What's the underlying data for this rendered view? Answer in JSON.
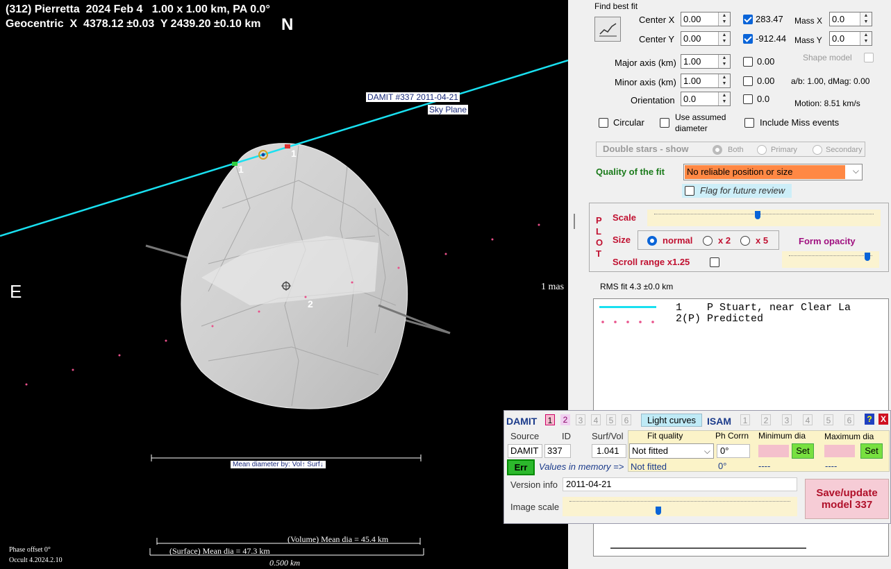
{
  "plot": {
    "title_line1": "(312) Pierretta  2024 Feb 4   1.00 x 1.00 km, PA 0.0°",
    "title_line2": "Geocentric  X  4378.12 ±0.03  Y 2439.20 ±0.10 km",
    "north": "N",
    "east": "E",
    "scale_mas": "1 mas",
    "damit_label_1": "DAMIT #337 2011-04-21",
    "damit_label_2": "Sky Plane",
    "chord_label_1": "1",
    "chord_label_1b": "1",
    "chord_label_2": "2",
    "mean_dia_label": "Mean diameter by:  Vol↑  Surf↓",
    "volume_dia": "(Volume) Mean dia = 45.4 km",
    "surface_dia": "(Surface) Mean dia = 47.3 km",
    "scale_bar_label": "0.500 km",
    "phase_offset": "Phase offset 0°",
    "version": "Occult 4.2024.2.10"
  },
  "fit": {
    "group_title": "Find best fit",
    "center_x_label": "Center X",
    "center_x_value": "0.00",
    "center_x_checked_value": "283.47",
    "center_y_label": "Center Y",
    "center_y_value": "0.00",
    "center_y_checked_value": "-912.44",
    "mass_x_label": "Mass X",
    "mass_x_value": "0.0",
    "mass_y_label": "Mass Y",
    "mass_y_value": "0.0",
    "major_label": "Major axis (km)",
    "major_value": "1.00",
    "major_check": "0.00",
    "minor_label": "Minor axis (km)",
    "minor_value": "1.00",
    "minor_check": "0.00",
    "orientation_label": "Orientation",
    "orientation_value": "0.0",
    "orientation_check": "0.0",
    "shape_model_label": "Shape model",
    "ab_text": "a/b: 1.00, dMag: 0.00",
    "motion_text": "Motion: 8.51 km/s",
    "circular_label": "Circular",
    "assumed_label_1": "Use assumed",
    "assumed_label_2": "diameter",
    "miss_label": "Include Miss events",
    "double_stars_label": "Double stars - show",
    "both_label": "Both",
    "primary_label": "Primary",
    "secondary_label": "Secondary",
    "quality_label": "Quality of the fit",
    "quality_value": "No reliable position or size",
    "flag_label": "Flag for future review"
  },
  "plotctl": {
    "side_letters": [
      "P",
      "L",
      "O",
      "T"
    ],
    "scale_label": "Scale",
    "scale_fraction": 0.47,
    "size_label": "Size",
    "size_normal": "normal",
    "size_x2": "x 2",
    "size_x5": "x 5",
    "form_opacity_label": "Form opacity",
    "opacity_fraction": 0.97,
    "scroll_label": "Scroll range x1.25"
  },
  "rms": {
    "label": "RMS fit 4.3 ±0.0 km"
  },
  "legend": {
    "row1": "1    P Stuart, near Clear La",
    "row2": "2(P) Predicted"
  },
  "damit": {
    "title": "DAMIT",
    "tabs": [
      "1",
      "2",
      "3",
      "4",
      "5",
      "6"
    ],
    "light_curves": "Light curves",
    "isam": "ISAM",
    "isam_tabs": [
      "1",
      "2",
      "3",
      "4",
      "5",
      "6"
    ],
    "help": "?",
    "close": "X",
    "source_hdr": "Source",
    "id_hdr": "ID",
    "surfvol_hdr": "Surf/Vol",
    "source_val": "DAMIT",
    "id_val": "337",
    "surfvol_val": "1.041",
    "fit_quality_hdr": "Fit quality",
    "ph_corrn_hdr": "Ph Corrn",
    "min_dia_hdr": "Minimum dia",
    "max_dia_hdr": "Maximum dia",
    "fit_quality_val": "Not fitted",
    "ph_corrn_val": "0°",
    "set": "Set",
    "err": "Err",
    "values_memory": "Values in memory =>",
    "mem_fit": "Not fitted",
    "mem_ph": "0°",
    "mem_min": "----",
    "mem_max": "----",
    "version_label": "Version info",
    "version_val": "2011-04-21",
    "image_scale_label": "Image scale",
    "image_scale_fraction": 0.4,
    "save_line1": "Save/update",
    "save_line2": "model 337"
  },
  "colors": {
    "chord": "#19e0f0",
    "predicted": "#e8508a",
    "quality_bg": "#ff8844",
    "save_bg": "#f6ccd6",
    "save_fg": "#b0102a",
    "damit_title": "#1a3a8a",
    "set_bg": "#78e040"
  }
}
